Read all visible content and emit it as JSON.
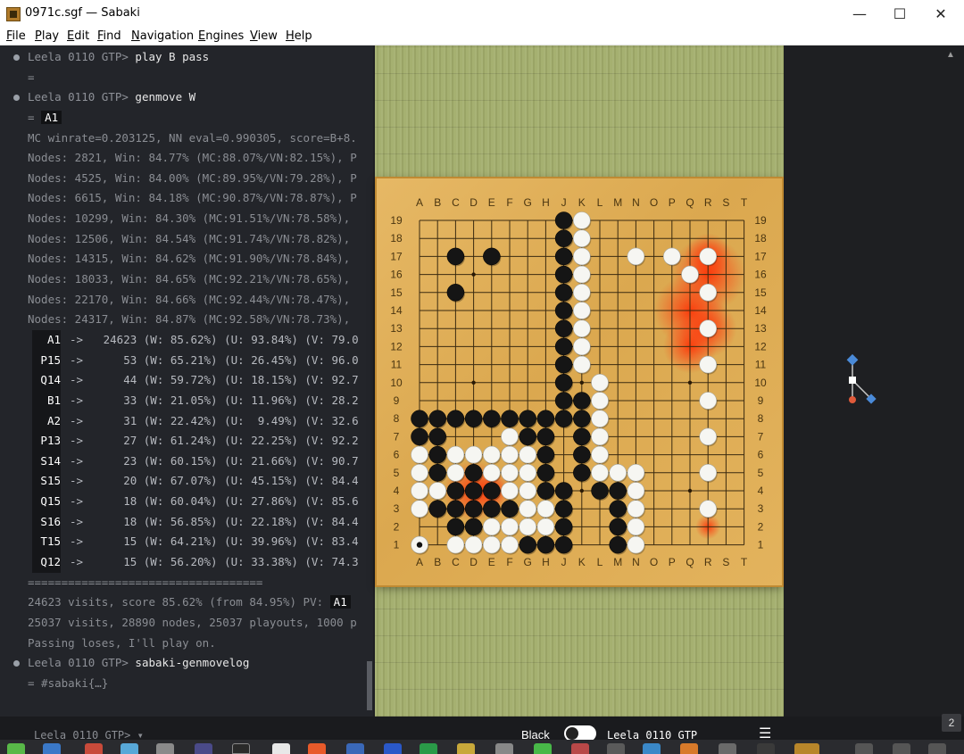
{
  "window": {
    "title": "0971c.sgf — Sabaki",
    "minimize": "—",
    "maximize": "☐",
    "close": "✕"
  },
  "menu": [
    "File",
    "Play",
    "Edit",
    "Find",
    "Navigation",
    "Engines",
    "View",
    "Help"
  ],
  "console": {
    "lines": [
      {
        "kind": "cmd",
        "prompt": "Leela 0110 GTP>",
        "command": "play B pass"
      },
      {
        "kind": "text",
        "text": "="
      },
      {
        "kind": "cmd",
        "prompt": "Leela 0110 GTP>",
        "command": "genmove W"
      },
      {
        "kind": "result",
        "text": "=",
        "value": "A1"
      },
      {
        "kind": "text",
        "text": "MC winrate=0.203125, NN eval=0.990305, score=B+8."
      },
      {
        "kind": "text",
        "text": "Nodes: 2821, Win: 84.77% (MC:88.07%/VN:82.15%), P"
      },
      {
        "kind": "text",
        "text": "Nodes: 4525, Win: 84.00% (MC:89.95%/VN:79.28%), P"
      },
      {
        "kind": "text",
        "text": "Nodes: 6615, Win: 84.18% (MC:90.87%/VN:78.87%), P"
      },
      {
        "kind": "text",
        "text": "Nodes: 10299, Win: 84.30% (MC:91.51%/VN:78.58%),"
      },
      {
        "kind": "text",
        "text": "Nodes: 12506, Win: 84.54% (MC:91.74%/VN:78.82%),"
      },
      {
        "kind": "text",
        "text": "Nodes: 14315, Win: 84.62% (MC:91.90%/VN:78.84%),"
      },
      {
        "kind": "text",
        "text": "Nodes: 18033, Win: 84.65% (MC:92.21%/VN:78.65%),"
      },
      {
        "kind": "text",
        "text": "Nodes: 22170, Win: 84.66% (MC:92.44%/VN:78.47%),"
      },
      {
        "kind": "text",
        "text": "Nodes: 24317, Win: 84.87% (MC:92.58%/VN:78.73%),"
      },
      {
        "kind": "move",
        "move": "A1",
        "text": "->   24623 (W: 85.62%) (U: 93.84%) (V: 79.0"
      },
      {
        "kind": "move",
        "move": "P15",
        "text": "->      53 (W: 65.21%) (U: 26.45%) (V: 96.0"
      },
      {
        "kind": "move",
        "move": "Q14",
        "text": "->      44 (W: 59.72%) (U: 18.15%) (V: 92.7"
      },
      {
        "kind": "move",
        "move": "B1",
        "text": "->      33 (W: 21.05%) (U: 11.96%) (V: 28.2"
      },
      {
        "kind": "move",
        "move": "A2",
        "text": "->      31 (W: 22.42%) (U:  9.49%) (V: 32.6"
      },
      {
        "kind": "move",
        "move": "P13",
        "text": "->      27 (W: 61.24%) (U: 22.25%) (V: 92.2"
      },
      {
        "kind": "move",
        "move": "S14",
        "text": "->      23 (W: 60.15%) (U: 21.66%) (V: 90.7"
      },
      {
        "kind": "move",
        "move": "S15",
        "text": "->      20 (W: 67.07%) (U: 45.15%) (V: 84.4"
      },
      {
        "kind": "move",
        "move": "Q15",
        "text": "->      18 (W: 60.04%) (U: 27.86%) (V: 85.6"
      },
      {
        "kind": "move",
        "move": "S16",
        "text": "->      18 (W: 56.85%) (U: 22.18%) (V: 84.4"
      },
      {
        "kind": "move",
        "move": "T15",
        "text": "->      15 (W: 64.21%) (U: 39.96%) (V: 83.4"
      },
      {
        "kind": "move",
        "move": "Q12",
        "text": "->      15 (W: 56.20%) (U: 33.38%) (V: 74.3"
      },
      {
        "kind": "text",
        "text": "==================================="
      },
      {
        "kind": "pv",
        "text": "24623 visits, score 85.62% (from 84.95%) PV:",
        "value": "A1"
      },
      {
        "kind": "text",
        "text": "25037 visits, 28890 nodes, 25037 playouts, 1000 p"
      },
      {
        "kind": "text",
        "text": "Passing loses, I'll play on."
      },
      {
        "kind": "cmd",
        "prompt": "Leela 0110 GTP>",
        "command": "sabaki-genmovelog"
      },
      {
        "kind": "text",
        "text": "= #sabaki{…}"
      }
    ]
  },
  "statusbar": {
    "console_prompt": "Leela 0110 GTP> ▾",
    "player_black": "Black",
    "player_white": "Leela 0110 GTP",
    "menu_icon": "☰",
    "move_number": "2"
  },
  "board": {
    "size": 19,
    "columns": [
      "A",
      "B",
      "C",
      "D",
      "E",
      "F",
      "G",
      "H",
      "J",
      "K",
      "L",
      "M",
      "N",
      "O",
      "P",
      "Q",
      "R",
      "S",
      "T"
    ],
    "rows": [
      "19",
      "18",
      "17",
      "16",
      "15",
      "14",
      "13",
      "12",
      "11",
      "10",
      "9",
      "8",
      "7",
      "6",
      "5",
      "4",
      "3",
      "2",
      "1"
    ],
    "last_move": "A1",
    "black": [
      "J19",
      "J18",
      "J17",
      "J16",
      "J15",
      "J14",
      "J13",
      "J12",
      "J11",
      "J10",
      "J9",
      "K9",
      "J8",
      "K8",
      "C17",
      "E17",
      "C15",
      "A8",
      "B8",
      "C8",
      "D8",
      "E8",
      "F8",
      "G8",
      "H8",
      "A7",
      "B7",
      "G7",
      "H7",
      "K7",
      "B6",
      "H6",
      "K6",
      "B5",
      "D5",
      "H5",
      "K5",
      "C4",
      "D4",
      "E4",
      "H4",
      "J4",
      "L4",
      "M4",
      "B3",
      "C3",
      "D3",
      "E3",
      "F3",
      "J3",
      "M3",
      "C2",
      "D2",
      "J2",
      "M2",
      "G1",
      "H1",
      "J1",
      "M1"
    ],
    "white": [
      "K19",
      "K18",
      "K17",
      "K16",
      "K15",
      "K14",
      "K13",
      "K12",
      "K11",
      "L10",
      "L9",
      "L8",
      "L7",
      "L6",
      "L5",
      "M5",
      "N5",
      "N4",
      "N3",
      "N2",
      "N1",
      "N17",
      "P17",
      "R17",
      "Q16",
      "R15",
      "R13",
      "R11",
      "R9",
      "R7",
      "R5",
      "R3",
      "A6",
      "A5",
      "A4",
      "A3",
      "B4",
      "C6",
      "C5",
      "D6",
      "E6",
      "F7",
      "F6",
      "F5",
      "E5",
      "G6",
      "G5",
      "F4",
      "G4",
      "G3",
      "H3",
      "H2",
      "E2",
      "F2",
      "G2",
      "A1",
      "C1",
      "D1",
      "E1",
      "F1"
    ]
  },
  "tree": {
    "colors": {
      "move": "#4a8ad8",
      "current": "#e05a3a"
    }
  }
}
